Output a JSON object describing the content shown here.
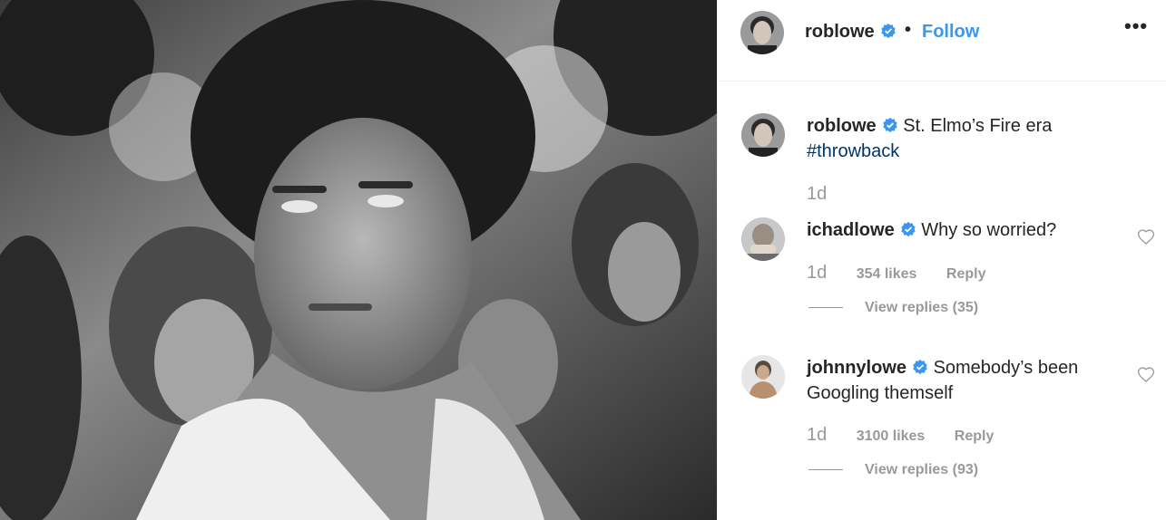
{
  "post": {
    "photo_alt": "black-and-white portrait",
    "author": "roblowe",
    "follow_label": "Follow",
    "separator": "•",
    "more_label": "•••",
    "caption": {
      "username": "roblowe",
      "text": "St. Elmo’s Fire era",
      "hashtag": "#throwback",
      "time": "1d"
    }
  },
  "comments": [
    {
      "username": "ichadlowe",
      "text": "Why so worried?",
      "time": "1d",
      "likes": "354 likes",
      "reply_label": "Reply",
      "view_replies": "View replies (35)"
    },
    {
      "username": "johnnylowe",
      "text": "Somebody’s been Googling themself",
      "time": "1d",
      "likes": "3100 likes",
      "reply_label": "Reply",
      "view_replies": "View replies (93)"
    }
  ],
  "colors": {
    "link_blue": "#3897f0",
    "verified_blue": "#3897f0",
    "hashtag": "#003569",
    "muted": "#999999"
  },
  "icons": [
    "verified-badge-icon",
    "more-options-icon",
    "heart-icon"
  ]
}
